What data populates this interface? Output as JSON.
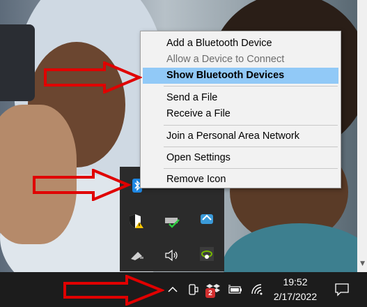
{
  "context_menu": {
    "items": [
      {
        "label": "Add a Bluetooth Device",
        "state": "normal"
      },
      {
        "label": "Allow a Device to Connect",
        "state": "disabled"
      },
      {
        "label": "Show Bluetooth Devices",
        "state": "highlighted"
      },
      {
        "label": "Send a File",
        "state": "normal"
      },
      {
        "label": "Receive a File",
        "state": "normal"
      },
      {
        "label": "Join a Personal Area Network",
        "state": "normal"
      },
      {
        "label": "Open Settings",
        "state": "normal"
      },
      {
        "label": "Remove Icon",
        "state": "normal"
      }
    ]
  },
  "tray_flyout": {
    "icons": [
      "bluetooth-icon",
      "windows-security-warning-icon",
      "network-drive-icon",
      "app-bird-icon",
      "usb-eject-icon",
      "volume-icon",
      "nvidia-icon"
    ]
  },
  "taskbar": {
    "icons": [
      "chevron-up-icon",
      "phone-link-icon",
      "dropbox-icon",
      "battery-icon",
      "wifi-icon",
      "notification-icon"
    ],
    "dropbox_badge": "2",
    "time": "19:52",
    "date": "2/17/2022"
  },
  "colors": {
    "menu_highlight": "#91c9f7",
    "menu_bg": "#f2f2f2",
    "taskbar_bg": "#1c1c1c",
    "annotation_red": "#e00000",
    "bluetooth_blue": "#1e88e5"
  }
}
